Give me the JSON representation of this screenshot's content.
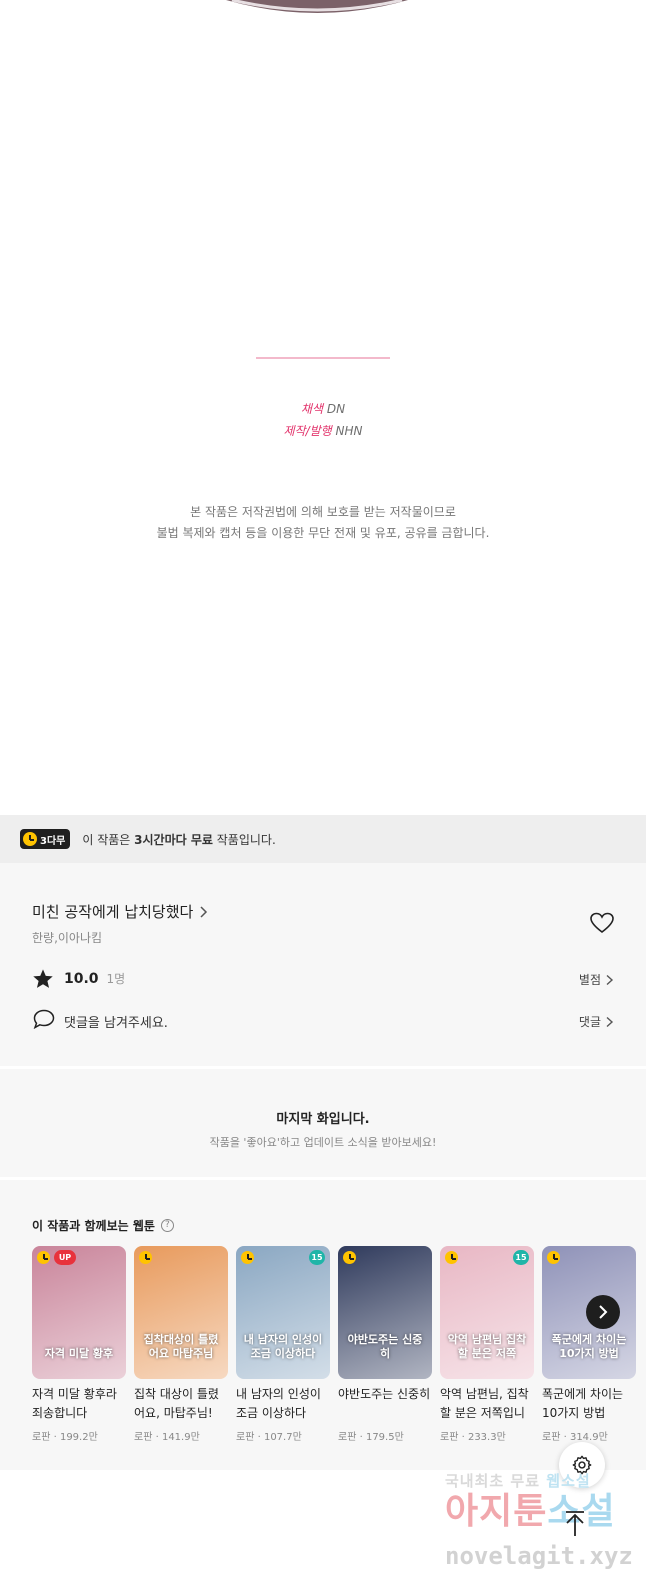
{
  "credits": {
    "art_role": "채색",
    "art_name": "DN",
    "pub_role": "제작/발행",
    "pub_name": "NHN"
  },
  "copyright": {
    "line1": "본 작품은 저작권법에 의해 보호를 받는 저작물이므로",
    "line2": "불법 복제와 캡처 등을 이용한 무단 전재 및 유포, 공유를 금합니다."
  },
  "free_banner": {
    "badge": "3다무",
    "text_pre": "이 작품은 ",
    "text_bold": "3시간마다 무료",
    "text_post": " 작품입니다."
  },
  "work": {
    "title": "미친 공작에게 납치당했다",
    "authors": "한량,이아나킴",
    "rating": "10.0",
    "rating_count": "1명",
    "rate_link": "별점",
    "comment_prompt": "댓글을 남겨주세요.",
    "comment_link": "댓글"
  },
  "last_episode": {
    "title": "마지막 화입니다.",
    "subtitle": "작품을 '좋아요'하고 업데이트 소식을 받아보세요!"
  },
  "recommendations": {
    "heading": "이 작품과 함께보는 웹툰",
    "items": [
      {
        "title": "자격 미달 황후라 죄송합니다",
        "genre": "로판",
        "views": "199.2만",
        "tag": "UP",
        "tag_color": "#e8323c",
        "cover_color": "#c9849a",
        "cover_text": "자격 미달 황후"
      },
      {
        "title": "집착 대상이 틀렸어요, 마탑주님!",
        "genre": "로판",
        "views": "141.9만",
        "tag": "",
        "tag_color": "",
        "cover_color": "#e89a5c",
        "cover_text": "집착대상이 틀렸어요 마탑주님"
      },
      {
        "title": "내 남자의 인성이 조금 이상하다",
        "genre": "로판",
        "views": "107.7만",
        "tag": "15",
        "tag_color": "#1fb5a8",
        "cover_color": "#8aa7c2",
        "cover_text": "내 남자의 인성이 조금 이상하다"
      },
      {
        "title": "야반도주는 신중히",
        "genre": "로판",
        "views": "179.5만",
        "tag": "",
        "tag_color": "",
        "cover_color": "#2f3a5c",
        "cover_text": "야반도주는 신중히"
      },
      {
        "title": "악역 남편님, 집착할 분은 저쪽입니다",
        "genre": "로판",
        "views": "233.3만",
        "tag": "15",
        "tag_color": "#1fb5a8",
        "cover_color": "#e8b7c4",
        "cover_text": "악역 남편님 집착할 분은 저쪽"
      },
      {
        "title": "폭군에게 차이는 10가지 방법",
        "genre": "로판",
        "views": "314.9만",
        "tag": "",
        "tag_color": "",
        "cover_color": "#8f92b8",
        "cover_text": "폭군에게 차이는 10가지 방법"
      }
    ]
  },
  "watermark": {
    "line1": "국내최초 무료",
    "line2": "웹소설",
    "brand": "아지툰",
    "brand2": "소설",
    "url": "novelagit.xyz"
  }
}
